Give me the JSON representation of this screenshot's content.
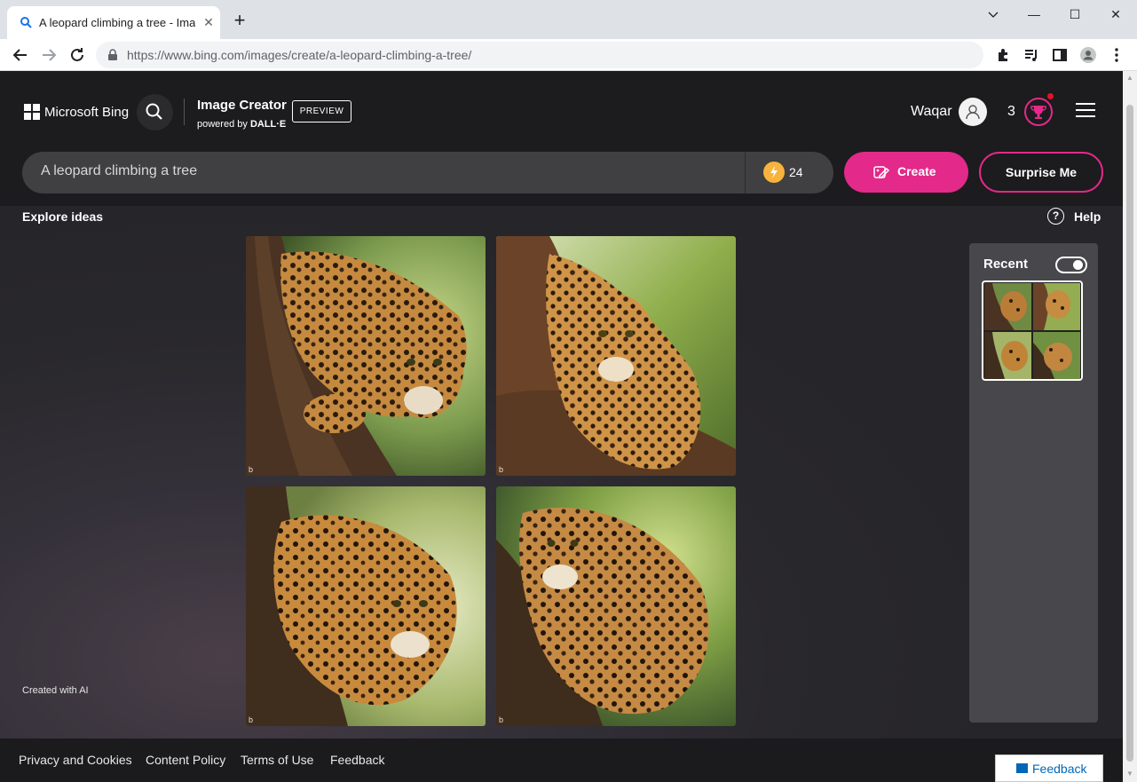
{
  "browser": {
    "tab_title": "A leopard climbing a tree - Image Creator",
    "url": "https://www.bing.com/images/create/a-leopard-climbing-a-tree/",
    "window_controls": {
      "minimize": "—",
      "maximize": "☐",
      "close": "✕"
    },
    "tab_close": "✕",
    "new_tab": "+"
  },
  "header": {
    "brand": "Microsoft Bing",
    "app_title": "Image Creator",
    "powered_prefix": "powered by ",
    "powered_name": "DALL·E",
    "badge": "PREVIEW",
    "username": "Waqar",
    "points": "3"
  },
  "prompt": {
    "text": "A leopard climbing a tree",
    "boosts": "24",
    "create_label": "Create",
    "surprise_label": "Surprise Me"
  },
  "main": {
    "explore_label": "Explore ideas",
    "help_label": "Help",
    "help_glyph": "?",
    "created_with_ai": "Created with AI",
    "watermark": "b"
  },
  "recent": {
    "title": "Recent",
    "toggle_on": true
  },
  "footer": {
    "links": [
      "Privacy and Cookies",
      "Content Policy",
      "Terms of Use",
      "Feedback"
    ],
    "feedback_button": "Feedback"
  },
  "colors": {
    "accent": "#e3298a",
    "page_bg": "#1e1d1f",
    "prompt_bg": "#403f42",
    "boost": "#f7b33c",
    "feedback_blue": "#0067b8"
  },
  "icons": [
    "search-icon",
    "lightning-icon",
    "create-icon",
    "help-icon",
    "user-icon",
    "trophy-icon",
    "menu-icon",
    "extensions-icon",
    "media-icon",
    "sidepanel-icon",
    "profile-icon",
    "more-icon"
  ]
}
